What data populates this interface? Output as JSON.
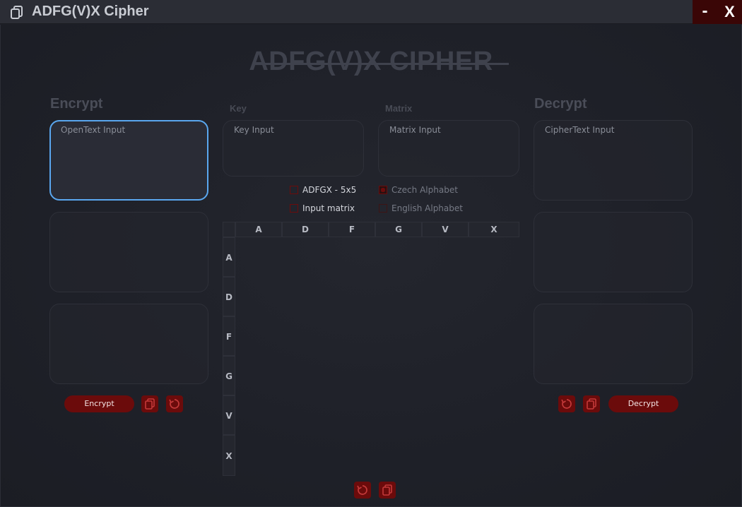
{
  "window": {
    "title": "ADFG(V)X Cipher",
    "minimize_label": "-",
    "close_label": "X"
  },
  "banner": "ADFG(V)X CIPHER",
  "encrypt": {
    "title": "Encrypt",
    "input_placeholder": "OpenText Input",
    "button_label": "Encrypt"
  },
  "key": {
    "label": "Key",
    "placeholder": "Key Input"
  },
  "matrix": {
    "label": "Matrix",
    "placeholder": "Matrix Input",
    "columns": [
      "A",
      "D",
      "F",
      "G",
      "V",
      "X"
    ],
    "rows": [
      "A",
      "D",
      "F",
      "G",
      "V",
      "X"
    ]
  },
  "decrypt": {
    "title": "Decrypt",
    "input_placeholder": "CipherText Input",
    "button_label": "Decrypt"
  },
  "options": {
    "adfgx": {
      "label": "ADFGX - 5x5",
      "checked": false
    },
    "input_matrix": {
      "label": "Input matrix",
      "checked": false
    },
    "czech": {
      "label": "Czech Alphabet",
      "checked": true
    },
    "english": {
      "label": "English Alphabet",
      "checked": false
    }
  },
  "icons": {
    "app": "copy-icon",
    "copy": "copy-icon",
    "reset": "refresh-icon"
  },
  "colors": {
    "accent_red": "#6b0b0b",
    "focus_blue": "#5aa7ef",
    "background": "#1d1f27"
  }
}
